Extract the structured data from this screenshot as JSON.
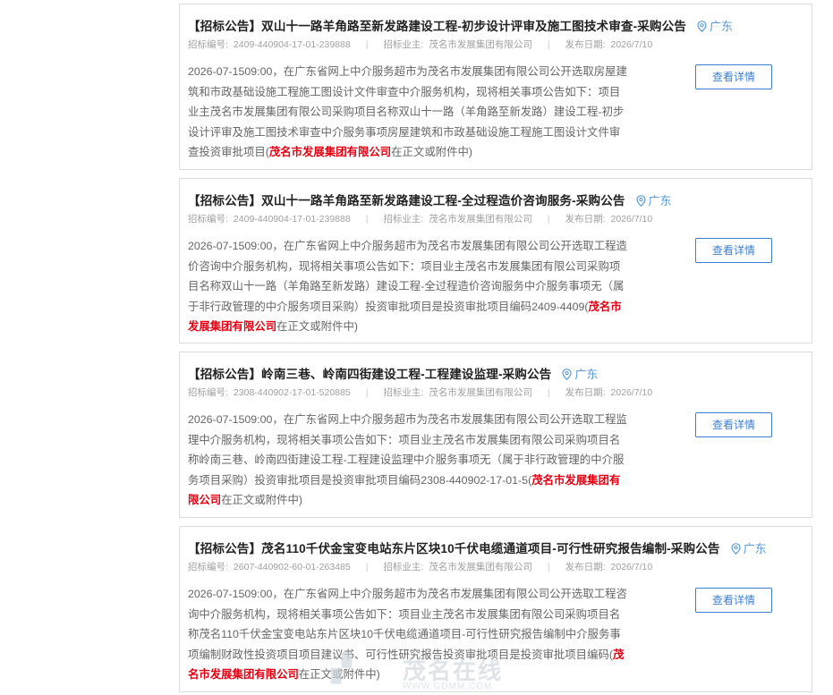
{
  "colors": {
    "accent": "#3b7fd1",
    "highlight": "#e60012",
    "region": "#5a9bd5"
  },
  "labels": {
    "tender_no": "招标编号:",
    "owner": "招标业主:",
    "publish_date": "发布日期:",
    "in_body_suffix": "在正文或附件中)",
    "details_button": "查看详情"
  },
  "listings": [
    {
      "title": "【招标公告】双山十一路羊角路至新发路建设工程-初步设计评审及施工图技术审查-采购公告",
      "region": "广东",
      "tender_no": "2409-440904-17-01-239888",
      "owner": "茂名市发展集团有限公司",
      "date": "2026/7/10",
      "description": "2026-07-1509:00，在广东省网上中介服务超市为茂名市发展集团有限公司公开选取房屋建筑和市政基础设施工程施工图设计文件审查中介服务机构，现将相关事项公告如下：项目业主茂名市发展集团有限公司采购项目名称双山十一路（羊角路至新发路）建设工程-初步设计评审及施工图技术审查中介服务事项房屋建筑和市政基础设施工程施工图设计文件审查投资审批项目(",
      "highlight": "茂名市发展集团有限公司"
    },
    {
      "title": "【招标公告】双山十一路羊角路至新发路建设工程-全过程造价咨询服务-采购公告",
      "region": "广东",
      "tender_no": "2409-440904-17-01-239888",
      "owner": "茂名市发展集团有限公司",
      "date": "2026/7/10",
      "description": "2026-07-1509:00，在广东省网上中介服务超市为茂名市发展集团有限公司公开选取工程造价咨询中介服务机构，现将相关事项公告如下：项目业主茂名市发展集团有限公司采购项目名称双山十一路（羊角路至新发路）建设工程-全过程造价咨询服务中介服务事项无（属于非行政管理的中介服务项目采购）投资审批项目是投资审批项目编码2409-4409(",
      "highlight": "茂名市发展集团有限公司"
    },
    {
      "title": "【招标公告】岭南三巷、岭南四街建设工程-工程建设监理-采购公告",
      "region": "广东",
      "tender_no": "2308-440902-17-01-520885",
      "owner": "茂名市发展集团有限公司",
      "date": "2026/7/10",
      "description": "2026-07-1509:00，在广东省网上中介服务超市为茂名市发展集团有限公司公开选取工程监理中介服务机构，现将相关事项公告如下：项目业主茂名市发展集团有限公司采购项目名称岭南三巷、岭南四街建设工程-工程建设监理中介服务事项无（属于非行政管理的中介服务项目采购）投资审批项目是投资审批项目编码2308-440902-17-01-5(",
      "highlight": "茂名市发展集团有限公司"
    },
    {
      "title": "【招标公告】茂名110千伏金宝变电站东片区块10千伏电缆通道项目-可行性研究报告编制-采购公告",
      "region": "广东",
      "tender_no": "2607-440902-60-01-263485",
      "owner": "茂名市发展集团有限公司",
      "date": "2026/7/10",
      "description": "2026-07-1509:00，在广东省网上中介服务超市为茂名市发展集团有限公司公开选取工程咨询中介服务机构，现将相关事项公告如下：项目业主茂名市发展集团有限公司采购项目名称茂名110千伏金宝变电站东片区块10千伏电缆通道项目-可行性研究报告编制中介服务事项编制财政性投资项目项目建议书、可行性研究报告投资审批项目是投资审批项目编码(",
      "highlight": "茂名市发展集团有限公司"
    }
  ],
  "watermark": {
    "brand": "茂名在线",
    "url": "WWW.GDMM.COM"
  }
}
